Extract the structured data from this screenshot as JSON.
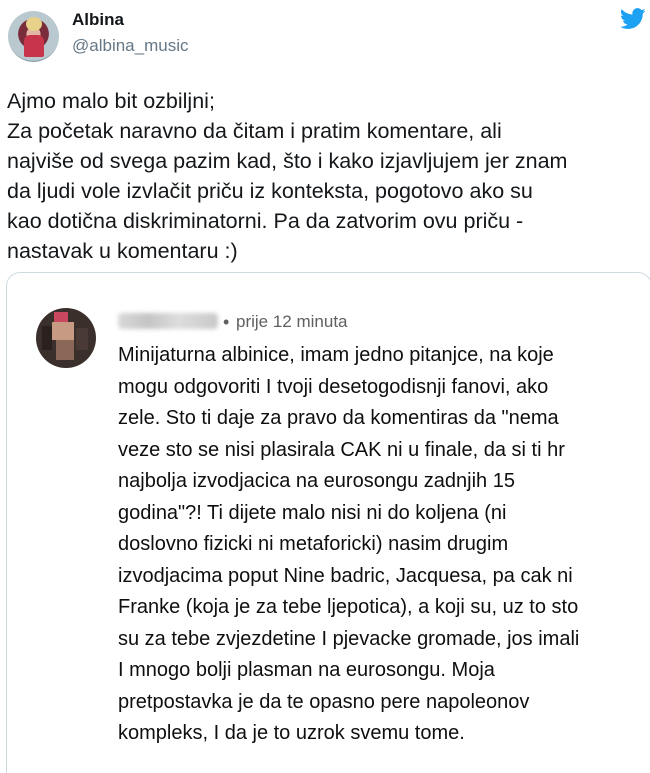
{
  "tweet": {
    "author": {
      "display_name": "Albina",
      "handle": "@albina_music"
    },
    "brand_icon": "twitter-bird-icon",
    "brand_color": "#1da1f2",
    "text_lines": [
      "Ajmo malo bit ozbiljni;",
      "Za početak naravno da čitam i pratim komentare, ali",
      "najviše od svega pazim kad, što i kako izjavljujem jer znam",
      "da ljudi vole izvlačit priču iz konteksta, pogotovo ako su",
      "kao dotična diskriminatorni. Pa da zatvorim ovu priču -",
      "nastavak u komentaru :)"
    ]
  },
  "comment": {
    "time_separator": "•",
    "time": "prije 12 minuta",
    "text_lines": [
      "Minijaturna albinice, imam jedno pitanjce, na koje",
      "mogu odgovoriti I tvoji desetogodisnji fanovi, ako",
      "zele. Sto ti daje za pravo da komentiras da \"nema",
      "veze sto se nisi plasirala CAK ni u finale, da si ti hr",
      "najbolja izvodjacica na eurosongu zadnjih 15",
      "godina\"?! Ti dijete malo nisi ni do koljena (ni",
      "doslovno fizicki ni metaforicki) nasim drugim",
      "izvodjacima poput Nine badric, Jacquesa, pa cak ni",
      "Franke (koja je za tebe ljepotica), a koji su, uz to sto",
      "su za tebe zvjezdetine I pjevacke gromade, jos imali",
      "I mnogo bolji plasman na eurosongu. Moja",
      "pretpostavka je da te opasno pere napoleonov",
      "kompleks, I da je to uzrok svemu tome."
    ]
  }
}
